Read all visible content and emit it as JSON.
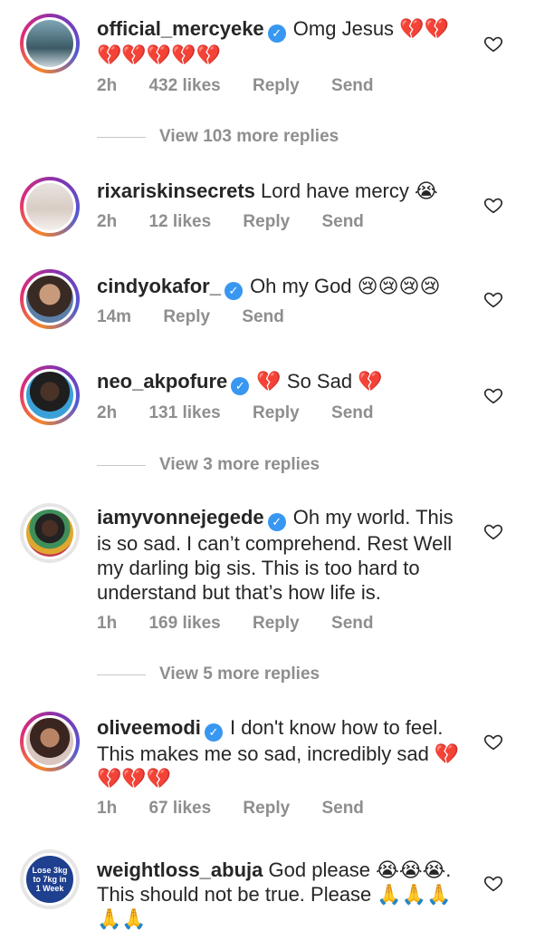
{
  "comments": [
    {
      "username": "official_mercyeke",
      "verified": true,
      "text": "Omg Jesus 💔💔 💔💔💔💔💔",
      "time": "2h",
      "likes": "432 likes",
      "reply": "Reply",
      "send": "Send",
      "avatar": "avatar-photo"
    },
    {
      "username": "rixariskinsecrets",
      "verified": false,
      "text": "Lord have mercy 😭",
      "time": "2h",
      "likes": "12 likes",
      "reply": "Reply",
      "send": "Send",
      "avatar": "avatar-photo"
    },
    {
      "username": "cindyokafor_",
      "verified": true,
      "text": "Oh my God 😢😢😢😢",
      "time": "14m",
      "likes": "",
      "reply": "Reply",
      "send": "Send",
      "avatar": "avatar-photo"
    },
    {
      "username": "neo_akpofure",
      "verified": true,
      "text": "💔 So Sad 💔",
      "time": "2h",
      "likes": "131 likes",
      "reply": "Reply",
      "send": "Send",
      "avatar": "avatar-photo"
    },
    {
      "username": "iamyvonnejegede",
      "verified": true,
      "text": "Oh my world. This is so sad. I can’t comprehend. Rest Well my darling big sis. This is too hard to understand but that’s how life is.",
      "time": "1h",
      "likes": "169 likes",
      "reply": "Reply",
      "send": "Send",
      "avatar": "avatar-photo"
    },
    {
      "username": "oliveemodi",
      "verified": true,
      "text": "I don't know how to feel. This makes me so sad, incredibly sad 💔💔💔💔",
      "time": "1h",
      "likes": "67 likes",
      "reply": "Reply",
      "send": "Send",
      "avatar": "avatar-photo"
    },
    {
      "username": "weightloss_abuja",
      "verified": false,
      "text": "God please 😭😭😭. This should not be true. Please 🙏🙏🙏 🙏🙏",
      "time": "",
      "likes": "",
      "reply": "",
      "send": "",
      "avatar": "avatar-ad",
      "avatar_text": "Lose 3kg to 7kg in 1 Week"
    }
  ],
  "view_more": [
    "View 103 more replies",
    "View 3 more replies",
    "View 5 more replies"
  ],
  "colors": {
    "verified": "#3897f0",
    "meta": "#8e8e8e",
    "text": "#262626",
    "ring_start": "#f58529",
    "ring_end": "#8134af"
  },
  "icons": {
    "like": "heart-outline-icon",
    "verified": "verified-badge-icon"
  }
}
